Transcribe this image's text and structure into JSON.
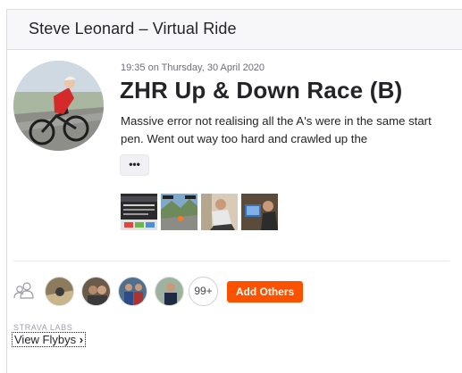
{
  "header": {
    "title": "Steve Leonard – Virtual Ride"
  },
  "activity": {
    "timestamp": "19:35 on Thursday, 30 April 2020",
    "title": "ZHR Up & Down Race (B)",
    "description": "Massive error not realising all the A's were in the same start pen. Went out way too hard and crawled up the",
    "more_label": "•••"
  },
  "photos": [
    {
      "alt": "Zwift results screen"
    },
    {
      "alt": "Zwift ride screenshot"
    },
    {
      "alt": "Rider on trainer"
    },
    {
      "alt": "Indoor setup"
    }
  ],
  "kudos": {
    "more_count": "99+",
    "add_others_label": "Add Others"
  },
  "flybys": {
    "labs_label": "STRAVA LABS",
    "link_label": "View Flybys",
    "chevron": "›"
  },
  "colors": {
    "accent": "#fc5200",
    "header_bg": "#f7f7fa"
  }
}
